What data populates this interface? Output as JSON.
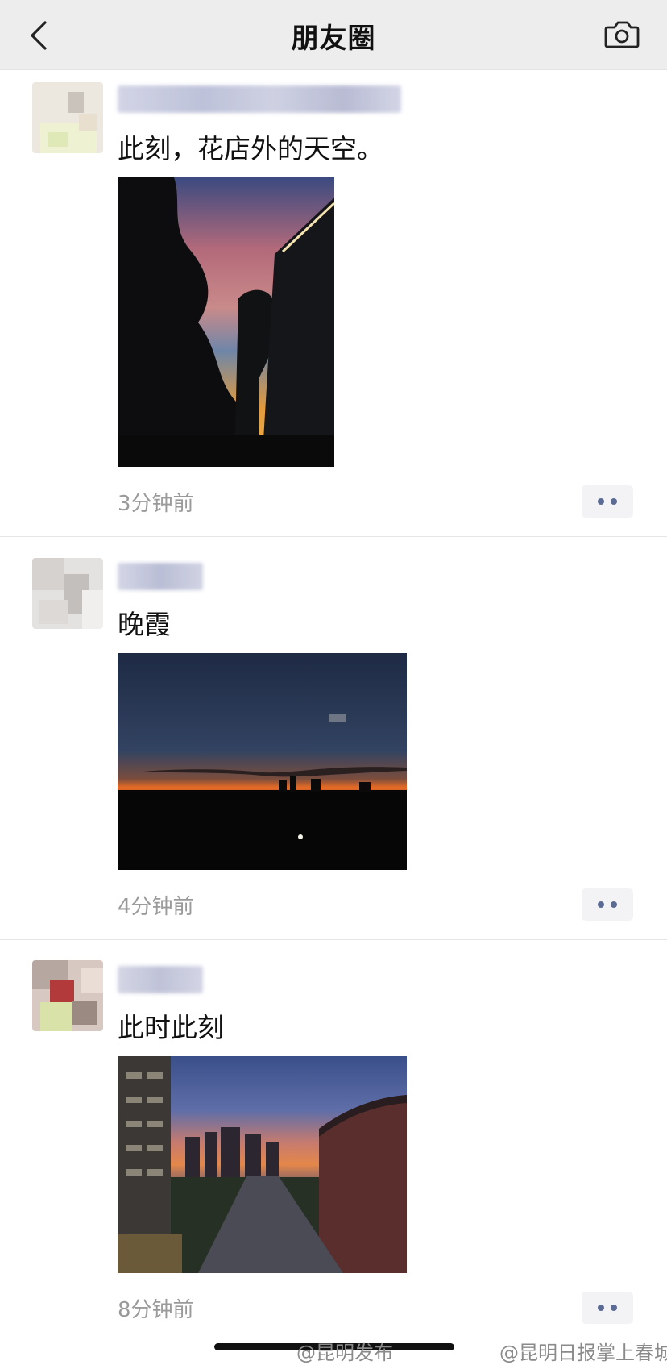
{
  "header": {
    "title": "朋友圈",
    "back_icon": "chevron-left-icon",
    "camera_icon": "camera-icon"
  },
  "posts": [
    {
      "text": "此刻，花店外的天空。",
      "time": "3分钟前"
    },
    {
      "text": "晚霞",
      "time": "4分钟前"
    },
    {
      "text": "此时此刻",
      "time": "8分钟前"
    }
  ],
  "watermarks": {
    "left": "@昆明发布",
    "right": "@昆明日报掌上春城"
  },
  "colors": {
    "header_bg": "#ededed",
    "timestamp": "#9a9a9a",
    "more_dots": "#5b6b93"
  }
}
